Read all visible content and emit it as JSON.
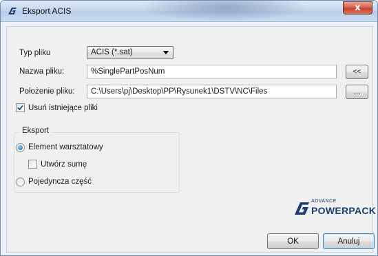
{
  "window": {
    "title": "Eksport ACIS",
    "close_label": "x"
  },
  "form": {
    "file_type_label": "Typ pliku",
    "file_type_value": "ACIS (*.sat)",
    "file_name_label": "Nazwa pliku:",
    "file_name_value": "%SinglePartPosNum",
    "file_name_button": "<<",
    "location_label": "Położenie pliku:",
    "location_value": "C:\\Users\\pj\\Desktop\\PP\\Rysunek1\\DSTV\\NC\\Files",
    "browse_button": "...",
    "delete_existing_label": "Usuń istniejące pliki",
    "delete_existing_checked": true
  },
  "export": {
    "group_title": "Eksport",
    "option_workshop_label": "Element warsztatowy",
    "option_workshop_selected": true,
    "create_sum_label": "Utwórz sumę",
    "create_sum_checked": false,
    "option_single_label": "Pojedyncza część",
    "option_single_selected": false
  },
  "brand": {
    "small": "ADVANCE",
    "big": "POWERPACK",
    "color": "#1b3e72"
  },
  "buttons": {
    "ok": "OK",
    "cancel": "Anuluj"
  }
}
